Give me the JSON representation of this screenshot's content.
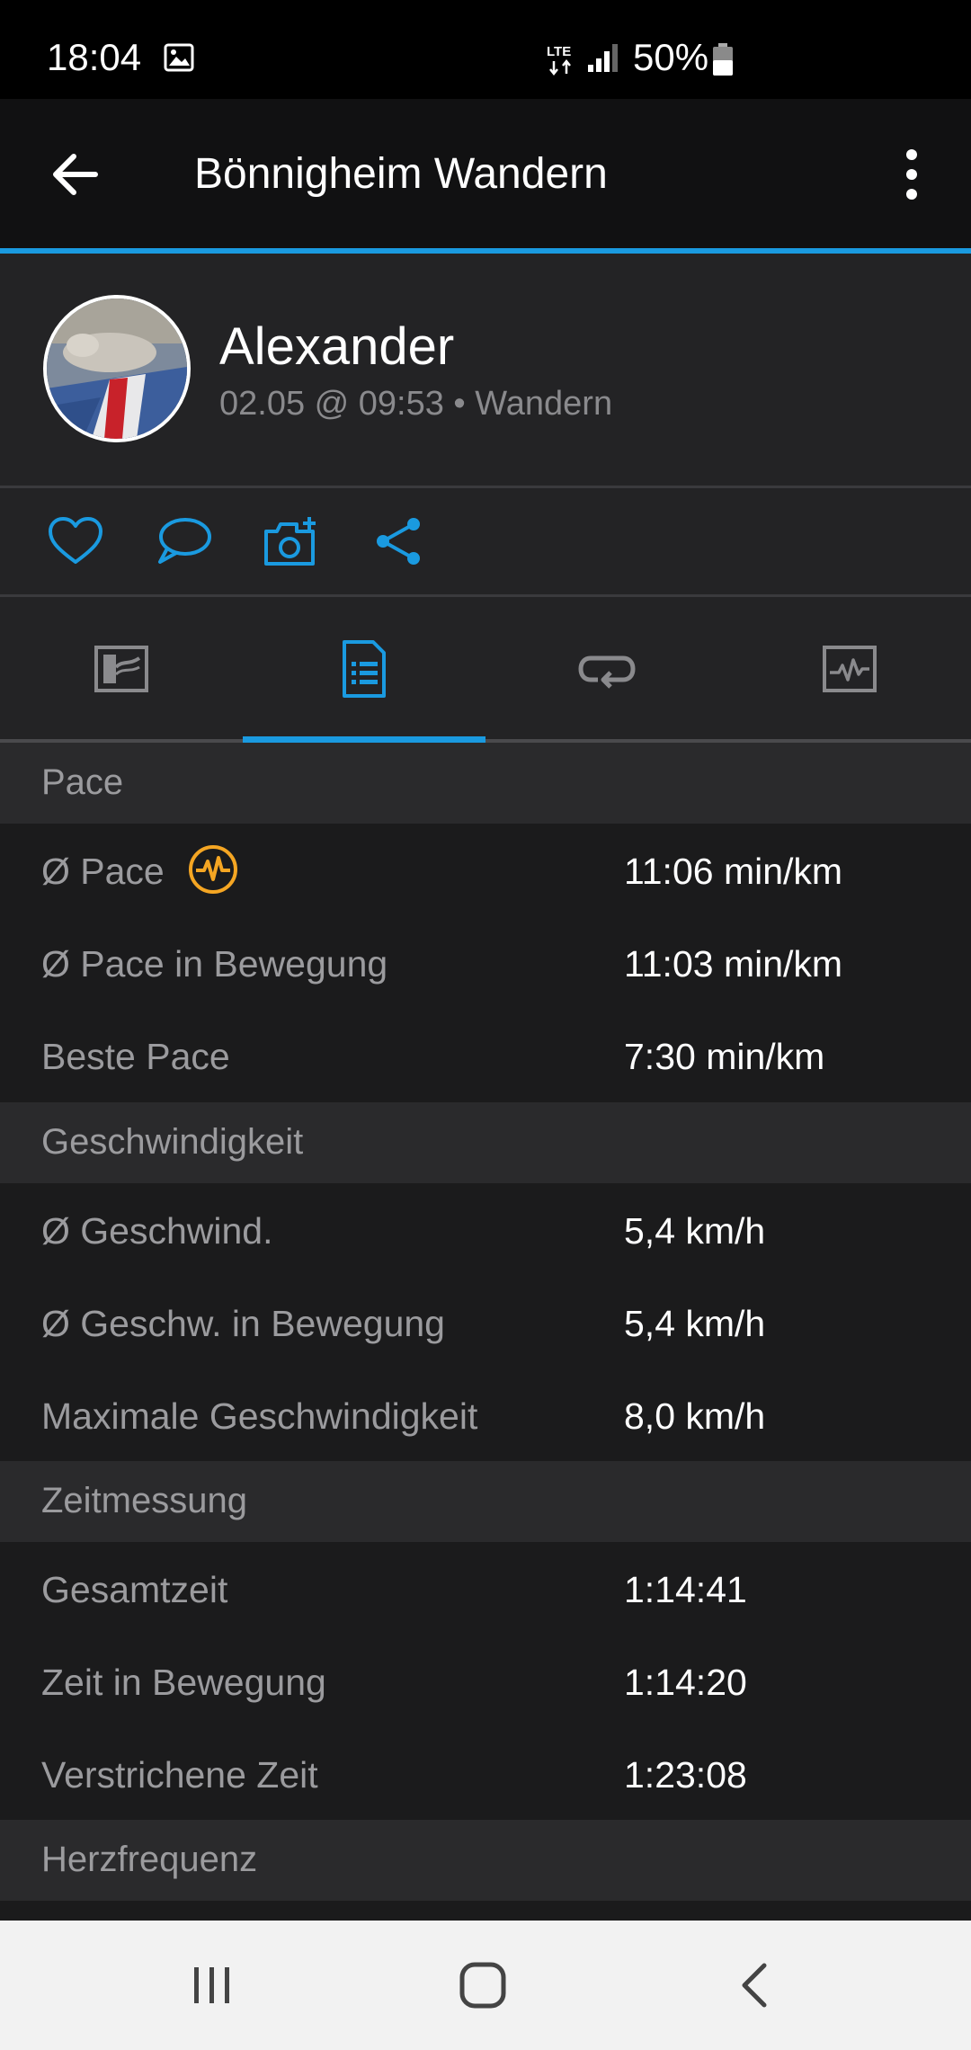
{
  "status_bar": {
    "time": "18:04",
    "battery": "50%",
    "network": "LTE",
    "icons": [
      "image-icon",
      "lte-icon",
      "signal-icon",
      "battery-icon"
    ]
  },
  "app_bar": {
    "title": "Bönnigheim Wandern",
    "icons": [
      "back-arrow-icon",
      "more-vert-icon"
    ]
  },
  "activity": {
    "user_name": "Alexander",
    "meta": "02.05 @ 09:53 • Wandern"
  },
  "actions": [
    "heart-icon",
    "comment-icon",
    "add-photo-icon",
    "share-icon"
  ],
  "tabs": [
    {
      "name": "map-tab",
      "icon": "map-icon",
      "active": false
    },
    {
      "name": "stats-tab",
      "icon": "document-list-icon",
      "active": true
    },
    {
      "name": "laps-tab",
      "icon": "loop-icon",
      "active": false
    },
    {
      "name": "charts-tab",
      "icon": "chart-icon",
      "active": false
    }
  ],
  "stats": {
    "pace": {
      "header": "Pace",
      "avg_label": "Ø Pace",
      "avg_value": "11:06 min/km",
      "moving_label": "Ø Pace in Bewegung",
      "moving_value": "11:03 min/km",
      "best_label": "Beste Pace",
      "best_value": "7:30 min/km"
    },
    "speed": {
      "header": "Geschwindigkeit",
      "avg_label": "Ø Geschwind.",
      "avg_value": "5,4 km/h",
      "moving_label": "Ø Geschw. in Bewegung",
      "moving_value": "5,4 km/h",
      "max_label": "Maximale Geschwindigkeit",
      "max_value": "8,0 km/h"
    },
    "timing": {
      "header": "Zeitmessung",
      "total_label": "Gesamtzeit",
      "total_value": "1:14:41",
      "moving_label": "Zeit in Bewegung",
      "moving_value": "1:14:20",
      "elapsed_label": "Verstrichene Zeit",
      "elapsed_value": "1:23:08"
    },
    "heart_rate": {
      "header": "Herzfrequenz"
    }
  },
  "colors": {
    "accent": "#1a9ae0",
    "highlight": "#f5a623",
    "background": "#1b1b1c",
    "section": "#2a2a2c"
  },
  "nav_bar": [
    "recent-apps-icon",
    "home-icon",
    "back-icon"
  ]
}
